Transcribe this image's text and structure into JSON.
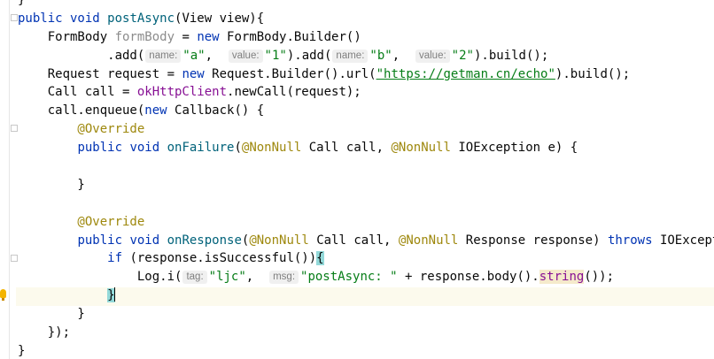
{
  "editor": {
    "lines": [
      [
        {
          "t": "}",
          "c": "pl"
        }
      ],
      [
        {
          "t": "public void ",
          "c": "kw"
        },
        {
          "t": "postAsync",
          "c": "fn"
        },
        {
          "t": "(View view){",
          "c": "pl"
        }
      ],
      [
        {
          "t": "    FormBody ",
          "c": "pl"
        },
        {
          "t": "formBody",
          "c": "gry"
        },
        {
          "t": " = ",
          "c": "pl"
        },
        {
          "t": "new",
          "c": "kw"
        },
        {
          "t": " FormBody.Builder()",
          "c": "pl"
        }
      ],
      [
        {
          "t": "            .add(",
          "c": "pl"
        },
        {
          "t": "name:",
          "c": "hint"
        },
        {
          "t": "\"a\"",
          "c": "str"
        },
        {
          "t": ",  ",
          "c": "pl"
        },
        {
          "t": "value:",
          "c": "hint"
        },
        {
          "t": "\"1\"",
          "c": "str"
        },
        {
          "t": ").add(",
          "c": "pl"
        },
        {
          "t": "name:",
          "c": "hint"
        },
        {
          "t": "\"b\"",
          "c": "str"
        },
        {
          "t": ",  ",
          "c": "pl"
        },
        {
          "t": "value:",
          "c": "hint"
        },
        {
          "t": "\"2\"",
          "c": "str"
        },
        {
          "t": ").build();",
          "c": "pl"
        }
      ],
      [
        {
          "t": "    Request request = ",
          "c": "pl"
        },
        {
          "t": "new",
          "c": "kw"
        },
        {
          "t": " Request.Builder().url(",
          "c": "pl"
        },
        {
          "t": "\"https://getman.cn/echo\"",
          "c": "url"
        },
        {
          "t": ").build();",
          "c": "pl"
        }
      ],
      [
        {
          "t": "    Call call = ",
          "c": "pl"
        },
        {
          "t": "okHttpClient",
          "c": "fld"
        },
        {
          "t": ".newCall(request);",
          "c": "pl"
        }
      ],
      [
        {
          "t": "    call.enqueue(",
          "c": "pl"
        },
        {
          "t": "new",
          "c": "kw"
        },
        {
          "t": " Callback() {",
          "c": "pl"
        }
      ],
      [
        {
          "t": "        @Override",
          "c": "ann"
        }
      ],
      [
        {
          "t": "        ",
          "c": "pl"
        },
        {
          "t": "public void ",
          "c": "kw"
        },
        {
          "t": "onFailure",
          "c": "fn"
        },
        {
          "t": "(",
          "c": "pl"
        },
        {
          "t": "@NonNull",
          "c": "ann"
        },
        {
          "t": " Call call, ",
          "c": "pl"
        },
        {
          "t": "@NonNull",
          "c": "ann"
        },
        {
          "t": " IOException e) {",
          "c": "pl"
        }
      ],
      [
        {
          "t": "",
          "c": "pl"
        }
      ],
      [
        {
          "t": "        }",
          "c": "pl"
        }
      ],
      [
        {
          "t": "",
          "c": "pl"
        }
      ],
      [
        {
          "t": "        @Override",
          "c": "ann"
        }
      ],
      [
        {
          "t": "        ",
          "c": "pl"
        },
        {
          "t": "public void ",
          "c": "kw"
        },
        {
          "t": "onResponse",
          "c": "fn"
        },
        {
          "t": "(",
          "c": "pl"
        },
        {
          "t": "@NonNull",
          "c": "ann"
        },
        {
          "t": " Call call, ",
          "c": "pl"
        },
        {
          "t": "@NonNull",
          "c": "ann"
        },
        {
          "t": " Response response) ",
          "c": "pl"
        },
        {
          "t": "throws",
          "c": "kw"
        },
        {
          "t": " IOException {",
          "c": "pl"
        }
      ],
      [
        {
          "t": "            ",
          "c": "pl"
        },
        {
          "t": "if",
          "c": "kw"
        },
        {
          "t": " (response.isSuccessful())",
          "c": "pl"
        },
        {
          "t": "{",
          "c": "bhl"
        }
      ],
      [
        {
          "t": "                Log.",
          "c": "pl"
        },
        {
          "t": "i",
          "c": "pl"
        },
        {
          "t": "(",
          "c": "pl"
        },
        {
          "t": "tag:",
          "c": "hint"
        },
        {
          "t": "\"ljc\"",
          "c": "str"
        },
        {
          "t": ",  ",
          "c": "pl"
        },
        {
          "t": "msg:",
          "c": "hint"
        },
        {
          "t": "\"postAsync: \"",
          "c": "str"
        },
        {
          "t": " + response.body().",
          "c": "pl"
        },
        {
          "t": "string",
          "c": "shl"
        },
        {
          "t": "());",
          "c": "pl"
        }
      ],
      [
        {
          "t": "            ",
          "c": "pl"
        },
        {
          "t": "}",
          "c": "bhl"
        },
        {
          "t": "",
          "c": "caret"
        }
      ],
      [
        {
          "t": "        }",
          "c": "pl"
        }
      ],
      [
        {
          "t": "    });",
          "c": "pl"
        }
      ],
      [
        {
          "t": "}",
          "c": "pl"
        }
      ]
    ]
  }
}
